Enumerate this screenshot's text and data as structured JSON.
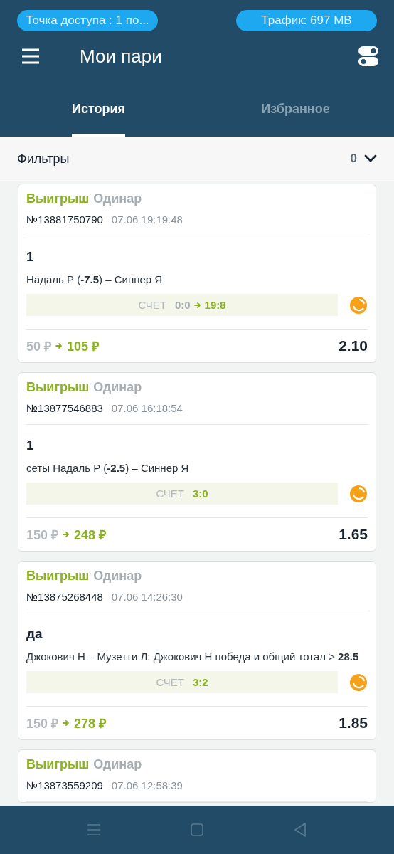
{
  "status_pills": [
    {
      "text": "Точка доступа : 1 по..."
    },
    {
      "text": "Трафик: 697 MB"
    }
  ],
  "header": {
    "title": "Мои пари"
  },
  "tabs": [
    {
      "label": "История",
      "selected": true
    },
    {
      "label": "Избранное",
      "selected": false
    }
  ],
  "filters": {
    "label": "Фильтры",
    "count": "0",
    "expanded": false
  },
  "bets": [
    {
      "result": "Выигрыш",
      "type": "Одинар",
      "number": "№13881750790",
      "datetime": "07.06 19:19:48",
      "pick": "1",
      "event": "Надаль Р (**-7.5**) – Синнер Я",
      "score_label": "СЧЕТ",
      "score_from": "0:0",
      "score_to": "19:8",
      "stake": "50 ₽",
      "payout": "105 ₽",
      "odds": "2.10"
    },
    {
      "result": "Выигрыш",
      "type": "Одинар",
      "number": "№13877546883",
      "datetime": "07.06 16:18:54",
      "pick": "1",
      "event": "сеты Надаль Р (**-2.5**) – Синнер Я",
      "score_label": "СЧЕТ",
      "score_to": "3:0",
      "stake": "150 ₽",
      "payout": "248 ₽",
      "odds": "1.65"
    },
    {
      "result": "Выигрыш",
      "type": "Одинар",
      "number": "№13875268448",
      "datetime": "07.06 14:26:30",
      "pick": "да",
      "event": "Джокович Н – Музетти Л: Джокович Н победа и общий тотал > **28.5**",
      "score_label": "СЧЕТ",
      "score_to": "3:2",
      "stake": "150 ₽",
      "payout": "278 ₽",
      "odds": "1.85"
    },
    {
      "result": "Выигрыш",
      "type": "Одинар",
      "number": "№13873559209",
      "datetime": "07.06 12:58:39"
    }
  ]
}
